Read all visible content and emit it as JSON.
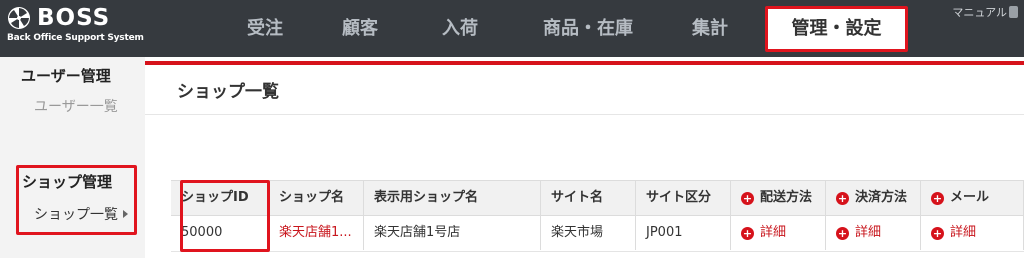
{
  "app": {
    "logo_text": "BOSS",
    "logo_subtitle": "Back Office Support System"
  },
  "nav": {
    "items": [
      {
        "label": "受注"
      },
      {
        "label": "顧客"
      },
      {
        "label": "入荷"
      },
      {
        "label": "商品・在庫"
      },
      {
        "label": "集計"
      },
      {
        "label": "管理・設定"
      }
    ],
    "active": "管理・設定",
    "manual_label": "マニュアル"
  },
  "sidebar": {
    "sections": [
      {
        "heading": "ユーザー管理",
        "links": [
          {
            "label": "ユーザー一覧"
          }
        ]
      },
      {
        "heading": "ショップ管理",
        "links": [
          {
            "label": "ショップ一覧"
          }
        ]
      }
    ]
  },
  "main": {
    "title": "ショップ一覧",
    "table": {
      "columns": [
        "ショップID",
        "ショップ名",
        "表示用ショップ名",
        "サイト名",
        "サイト区分",
        "配送方法",
        "決済方法",
        "メール"
      ],
      "rows": [
        {
          "shop_id": "50000",
          "shop_name": "楽天店舗1...",
          "display_name": "楽天店舗1号店",
          "site_name": "楽天市場",
          "site_type": "JP001",
          "shipping": "詳細",
          "payment": "詳細",
          "mail": "詳細"
        }
      ]
    }
  },
  "colors": {
    "topbar": "#363a3f",
    "accent_red": "#e0141e",
    "sidebar_bg": "#f3f3f3",
    "link_red": "#c8161d"
  }
}
